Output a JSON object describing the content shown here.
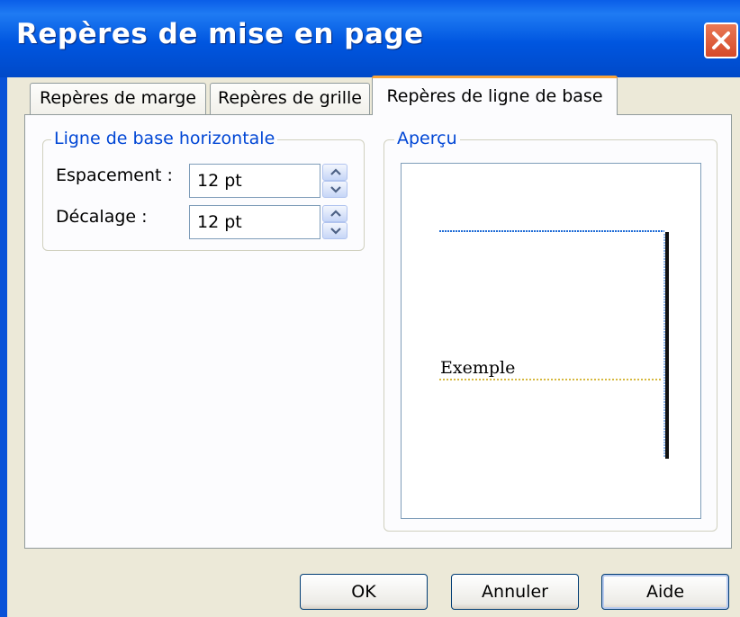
{
  "window": {
    "title": "Repères de mise en page",
    "close_icon": "close-icon"
  },
  "tabs": [
    {
      "label": "Repères de marge",
      "active": false
    },
    {
      "label": "Repères de grille",
      "active": false
    },
    {
      "label": "Repères de ligne de base",
      "active": true
    }
  ],
  "horizontal_baseline": {
    "group_label": "Ligne de base horizontale",
    "spacing": {
      "label": "Espacement :",
      "value": "12 pt"
    },
    "offset": {
      "label": "Décalage :",
      "value": "12 pt"
    }
  },
  "preview": {
    "group_label": "Aperçu",
    "sample_text": "Exemple"
  },
  "buttons": {
    "ok": "OK",
    "cancel": "Annuler",
    "help": "Aide"
  },
  "colors": {
    "titlebar": "#0058e6",
    "group_label": "#0046d5",
    "active_tab_highlight": "#f9a43a",
    "baseline_top_line": "#1e6bd6",
    "baseline_sample_line": "#c8a200"
  }
}
